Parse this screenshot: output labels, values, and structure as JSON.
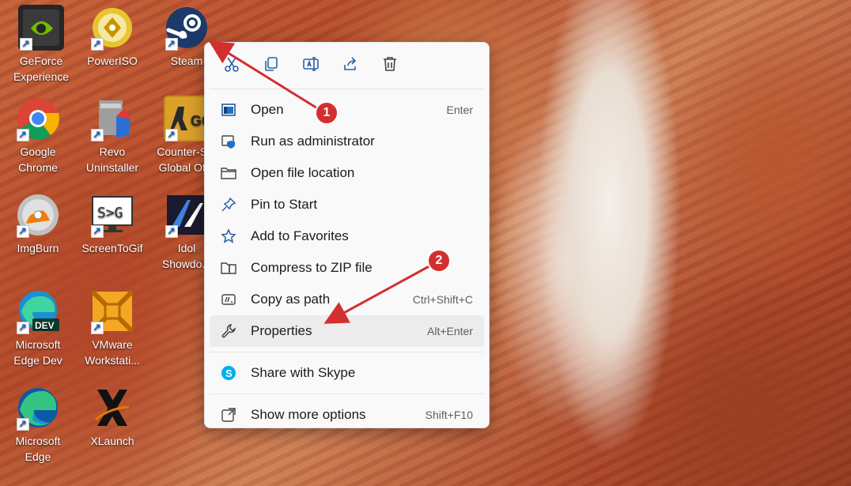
{
  "desktop": {
    "icons": [
      {
        "label": "GeForce Experience",
        "icon": "geforce-icon"
      },
      {
        "label": "PowerISO",
        "icon": "poweriso-icon"
      },
      {
        "label": "Steam",
        "icon": "steam-icon"
      },
      {
        "label": "Google Chrome",
        "icon": "chrome-icon"
      },
      {
        "label": "Revo Uninstaller",
        "icon": "revo-uninstaller-icon"
      },
      {
        "label": "Counter-S... Global Of...",
        "icon": "csgo-icon"
      },
      {
        "label": "ImgBurn",
        "icon": "imgburn-icon"
      },
      {
        "label": "ScreenToGif",
        "icon": "screentogif-icon"
      },
      {
        "label": "Idol Showdo...",
        "icon": "idol-showdown-icon"
      },
      {
        "label": "Microsoft Edge Dev",
        "icon": "edge-dev-icon"
      },
      {
        "label": "VMware Workstati...",
        "icon": "vmware-icon"
      },
      {
        "label": "Microsoft Edge",
        "icon": "edge-icon"
      },
      {
        "label": "XLaunch",
        "icon": "xlaunch-icon"
      }
    ]
  },
  "context_menu": {
    "toolbar": [
      {
        "name": "cut",
        "icon": "scissors-icon"
      },
      {
        "name": "copy",
        "icon": "copy-icon"
      },
      {
        "name": "rename",
        "icon": "rename-icon"
      },
      {
        "name": "share",
        "icon": "share-icon"
      },
      {
        "name": "delete",
        "icon": "trash-icon"
      }
    ],
    "items": [
      {
        "label": "Open",
        "shortcut": "Enter",
        "icon": "open-window-icon"
      },
      {
        "label": "Run as administrator",
        "shortcut": "",
        "icon": "shield-icon"
      },
      {
        "label": "Open file location",
        "shortcut": "",
        "icon": "folder-icon"
      },
      {
        "label": "Pin to Start",
        "shortcut": "",
        "icon": "pin-icon"
      },
      {
        "label": "Add to Favorites",
        "shortcut": "",
        "icon": "star-icon"
      },
      {
        "label": "Compress to ZIP file",
        "shortcut": "",
        "icon": "zip-folder-icon"
      },
      {
        "label": "Copy as path",
        "shortcut": "Ctrl+Shift+C",
        "icon": "copy-path-icon"
      },
      {
        "label": "Properties",
        "shortcut": "Alt+Enter",
        "icon": "wrench-icon"
      },
      {
        "label": "Share with Skype",
        "shortcut": "",
        "icon": "skype-icon"
      },
      {
        "label": "Show more options",
        "shortcut": "Shift+F10",
        "icon": "more-options-icon"
      }
    ]
  },
  "annotations": [
    {
      "number": "1"
    },
    {
      "number": "2"
    }
  ],
  "colors": {
    "annotation_red": "#d32f2f",
    "menu_bg": "#f9f9f9",
    "accent_blue": "#0067c0"
  }
}
